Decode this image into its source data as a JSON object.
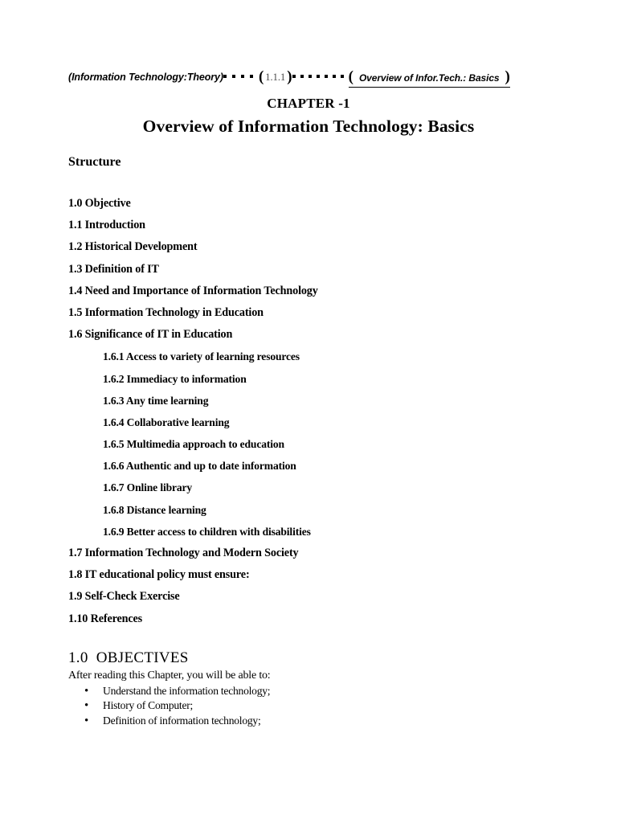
{
  "header": {
    "left_label": "(Information Technology:Theory)",
    "open_paren": "(",
    "page_number": "1.1.1",
    "close_paren": ")",
    "right_open_paren": "(",
    "right_label": "Overview of Infor.Tech.: Basics",
    "right_close_paren": ")",
    "leader_count_left": 4,
    "leader_count_right": 7
  },
  "title": {
    "chapter_label": "CHAPTER -1",
    "chapter_title": "Overview of Information Technology: Basics"
  },
  "structure": {
    "heading": "Structure",
    "items": [
      {
        "text": "1.0 Objective",
        "level": 1
      },
      {
        "text": "1.1 Introduction",
        "level": 1
      },
      {
        "text": "1.2 Historical Development",
        "level": 1
      },
      {
        "text": "1.3 Definition of IT",
        "level": 1
      },
      {
        "text": "1.4 Need and Importance of Information Technology",
        "level": 1
      },
      {
        "text": "1.5 Information Technology in Education",
        "level": 1
      },
      {
        "text": "1.6 Significance of IT in Education",
        "level": 1
      },
      {
        "text": "1.6.1 Access to variety of learning resources",
        "level": 2
      },
      {
        "text": "1.6.2 Immediacy to information",
        "level": 2
      },
      {
        "text": "1.6.3 Any time learning",
        "level": 2
      },
      {
        "text": "1.6.4 Collaborative learning",
        "level": 2
      },
      {
        "text": "1.6.5 Multimedia approach to education",
        "level": 2
      },
      {
        "text": "1.6.6 Authentic and up to date information",
        "level": 2
      },
      {
        "text": "1.6.7 Online library",
        "level": 2
      },
      {
        "text": "1.6.8 Distance learning",
        "level": 2
      },
      {
        "text": "1.6.9 Better access to children with disabilities",
        "level": 2
      },
      {
        "text": "1.7 Information Technology and Modern Society",
        "level": 1
      },
      {
        "text": "1.8 IT educational policy must ensure:",
        "level": 1
      },
      {
        "text": "1.9  Self-Check Exercise",
        "level": 1
      },
      {
        "text": "1.10  References",
        "level": 1
      }
    ]
  },
  "objectives": {
    "heading": "1.0  OBJECTIVES",
    "intro": "After reading this Chapter, you will be able to:",
    "bullet_glyph": "•",
    "bullets": [
      "Understand the information technology;",
      "History of Computer;",
      "Definition of information technology;"
    ]
  }
}
